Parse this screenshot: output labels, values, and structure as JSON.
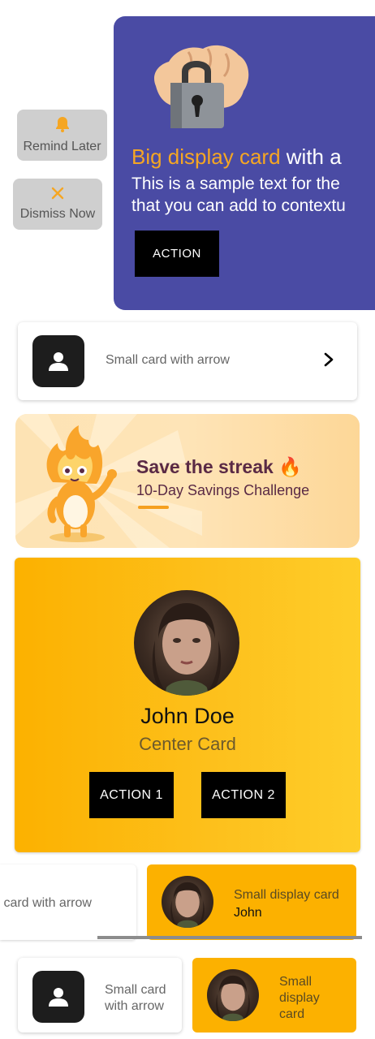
{
  "swipe_actions": {
    "remind_later": "Remind Later",
    "dismiss_now": "Dismiss Now",
    "icon_color": "#f5a623"
  },
  "big_card": {
    "title_highlight": "Big display card",
    "title_rest": " with a",
    "description_line1": "This is a sample text for the",
    "description_line2": "that you can add to contextu",
    "action_label": "ACTION",
    "background": "#4a4ba4",
    "illustration": "lock-hand-illustration"
  },
  "arrow_card": {
    "label": "Small card with arrow",
    "icon": "person-icon"
  },
  "streak_banner": {
    "title": "Save the streak 🔥",
    "subtitle": "10-Day Savings Challenge",
    "mascot": "flame-mascot"
  },
  "center_card": {
    "name": "John Doe",
    "subtitle": "Center Card",
    "action1_label": "ACTION 1",
    "action2_label": "ACTION 2",
    "accent": "#fcb100"
  },
  "scroll_row": {
    "partial_card_label": "all card with arrow",
    "display_card_title": "Small display card",
    "display_card_name": "John"
  },
  "bottom_row": {
    "arrow_card_label": "Small card with arrow",
    "display_card_label": "Small display card"
  }
}
